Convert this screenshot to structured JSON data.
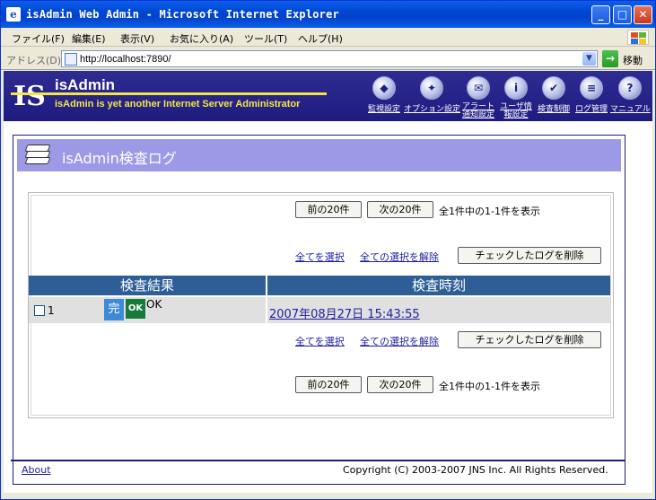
{
  "window": {
    "title": "isAdmin Web Admin - Microsoft Internet Explorer",
    "app_icon": "e",
    "min": "_",
    "max": "□",
    "close": "✕"
  },
  "menu": [
    "ファイル(F)",
    "編集(E)",
    "表示(V)",
    "お気に入り(A)",
    "ツール(T)",
    "ヘルプ(H)"
  ],
  "address": {
    "label": "アドレス(D)",
    "url": "http://localhost:7890/",
    "go_label": "移動",
    "go_icon": "→",
    "drop_icon": "▼"
  },
  "header": {
    "logo_glyph": "IS",
    "brand": "isAdmin",
    "tagline": "isAdmin is yet another Internet Server Administrator",
    "nav": [
      {
        "label": "監視設定",
        "icon": "monitor-icon"
      },
      {
        "label": "オプション設定",
        "icon": "option-icon"
      },
      {
        "label": "アラート通知設定",
        "icon": "alert-icon"
      },
      {
        "label": "ユーザ情報設定",
        "icon": "user-icon"
      },
      {
        "label": "検査制御",
        "icon": "inspect-icon"
      },
      {
        "label": "ログ管理",
        "icon": "log-icon"
      },
      {
        "label": "マニュアル",
        "icon": "manual-icon"
      }
    ]
  },
  "panel": {
    "title": "isAdmin検査ログ",
    "prev_label": "前の20件",
    "next_label": "次の20件",
    "count_text": "全1件中の1-1件を表示",
    "select_all": "全てを選択",
    "deselect_all": "全ての選択を解除",
    "delete_checked": "チェックしたログを削除",
    "columns": [
      "検査結果",
      "検査時刻"
    ],
    "rows": [
      {
        "num": "1",
        "badge_done": "完",
        "badge_ok": "OK",
        "status": "OK",
        "time": "2007年08月27日 15:43:55"
      }
    ]
  },
  "footer": {
    "about": "About",
    "copyright": "Copyright (C) 2003-2007 JNS Inc. All Rights Reserved."
  }
}
